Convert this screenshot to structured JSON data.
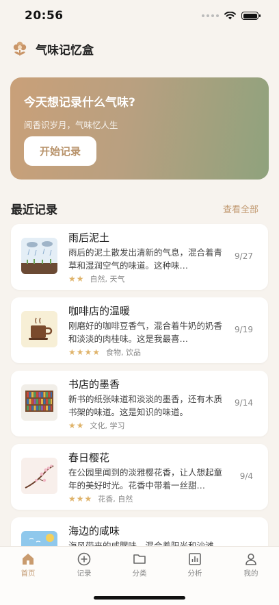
{
  "status": {
    "time": "20:56"
  },
  "header": {
    "title": "气味记忆盒",
    "logo_icon": "flower-icon"
  },
  "hero": {
    "title": "今天想记录什么气味?",
    "subtitle": "闻香识岁月，气味忆人生",
    "button_label": "开始记录"
  },
  "recent": {
    "title": "最近记录",
    "see_all": "查看全部",
    "items": [
      {
        "title": "雨后泥土",
        "desc": "雨后的泥土散发出清新的气息，混合着青草和湿润空气的味道。这种味…",
        "stars": "★★",
        "rating": 2,
        "tags": "自然, 天气",
        "date": "9/27",
        "thumb_icon": "rain-soil-thumbnail"
      },
      {
        "title": "咖啡店的温暖",
        "desc": "刚磨好的咖啡豆香气，混合着牛奶的奶香和淡淡的肉桂味。这是我最喜…",
        "stars": "★★★★",
        "rating": 4,
        "tags": "食物, 饮品",
        "date": "9/19",
        "thumb_icon": "coffee-cup-thumbnail"
      },
      {
        "title": "书店的墨香",
        "desc": "新书的纸张味道和淡淡的墨香，还有木质书架的味道。这是知识的味道。",
        "stars": "★★",
        "rating": 2,
        "tags": "文化, 学习",
        "date": "9/14",
        "thumb_icon": "bookshelf-thumbnail"
      },
      {
        "title": "春日樱花",
        "desc": "在公园里闻到的淡雅樱花香，让人想起童年的美好时光。花香中带着一丝甜…",
        "stars": "★★★",
        "rating": 3,
        "tags": "花香, 自然",
        "date": "9/4",
        "thumb_icon": "cherry-blossom-thumbnail"
      },
      {
        "title": "海边的咸味",
        "desc": "海风带来的咸腥味，混合着阳光和沙滩…",
        "thumb_icon": "seaside-thumbnail"
      }
    ]
  },
  "tabs": [
    {
      "label": "首页",
      "icon": "home-icon",
      "active": true
    },
    {
      "label": "记录",
      "icon": "plus-circle-icon"
    },
    {
      "label": "分类",
      "icon": "folder-icon"
    },
    {
      "label": "分析",
      "icon": "chart-icon"
    },
    {
      "label": "我的",
      "icon": "user-icon"
    }
  ],
  "colors": {
    "accent": "#c29a72",
    "star": "#dfb36a",
    "background": "#f7f3ee"
  }
}
